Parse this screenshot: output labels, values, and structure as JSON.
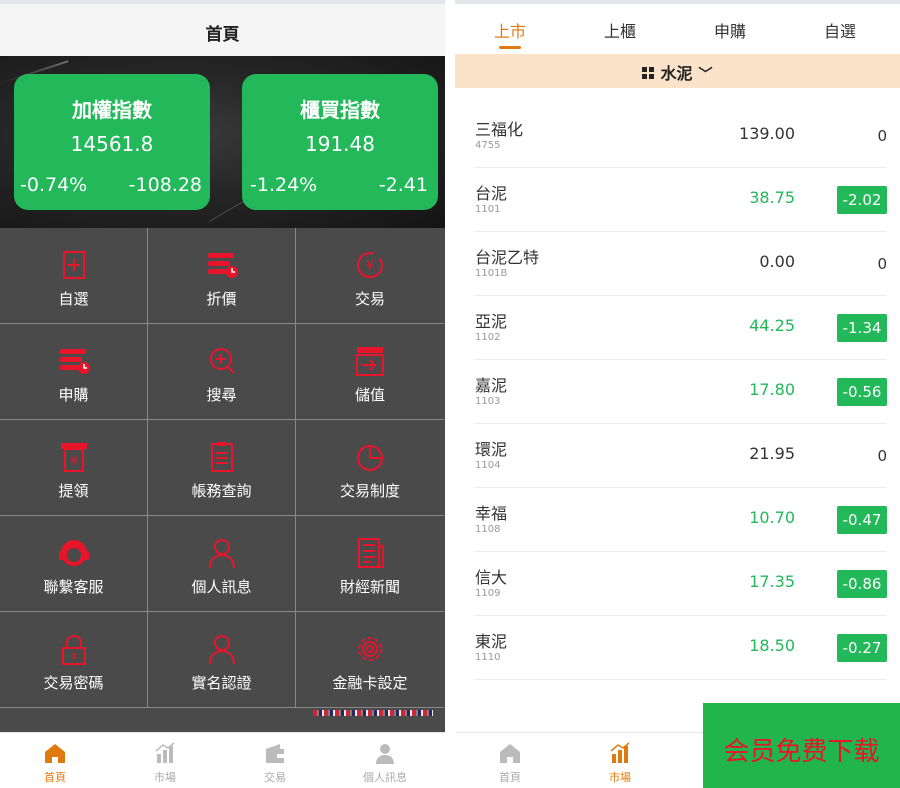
{
  "left": {
    "header_title": "首頁",
    "indices": [
      {
        "name": "加權指數",
        "value": "14561.8",
        "pct": "-0.74%",
        "change": "-108.28"
      },
      {
        "name": "櫃買指數",
        "value": "191.48",
        "pct": "-1.24%",
        "change": "-2.41"
      }
    ],
    "menu": [
      {
        "label": "自選",
        "icon": "add-favorite-icon"
      },
      {
        "label": "折價",
        "icon": "discount-stack-icon"
      },
      {
        "label": "交易",
        "icon": "yuan-coin-icon"
      },
      {
        "label": "申購",
        "icon": "subscribe-stack-icon"
      },
      {
        "label": "搜尋",
        "icon": "search-icon"
      },
      {
        "label": "儲值",
        "icon": "deposit-icon"
      },
      {
        "label": "提領",
        "icon": "withdraw-icon"
      },
      {
        "label": "帳務查詢",
        "icon": "ledger-icon"
      },
      {
        "label": "交易制度",
        "icon": "pie-chart-icon"
      },
      {
        "label": "聯繫客服",
        "icon": "customer-service-icon"
      },
      {
        "label": "個人訊息",
        "icon": "user-icon"
      },
      {
        "label": "財經新聞",
        "icon": "news-icon"
      },
      {
        "label": "交易密碼",
        "icon": "lock-icon"
      },
      {
        "label": "實名認證",
        "icon": "user-verify-icon"
      },
      {
        "label": "金融卡設定",
        "icon": "gear-icon"
      }
    ],
    "tabbar": [
      {
        "label": "首頁",
        "icon": "home-icon",
        "active": true
      },
      {
        "label": "市場",
        "icon": "market-chart-icon",
        "active": false
      },
      {
        "label": "交易",
        "icon": "wallet-icon",
        "active": false
      },
      {
        "label": "個人訊息",
        "icon": "profile-icon",
        "active": false
      }
    ]
  },
  "right": {
    "tabs": [
      {
        "label": "上市",
        "active": true
      },
      {
        "label": "上櫃",
        "active": false
      },
      {
        "label": "申購",
        "active": false
      },
      {
        "label": "自選",
        "active": false
      }
    ],
    "category": "水泥",
    "stocks": [
      {
        "name": "三福化",
        "code": "4755",
        "price": "139.00",
        "change": "0",
        "down": false
      },
      {
        "name": "台泥",
        "code": "1101",
        "price": "38.75",
        "change": "-2.02",
        "down": true
      },
      {
        "name": "台泥乙特",
        "code": "1101B",
        "price": "0.00",
        "change": "0",
        "down": false
      },
      {
        "name": "亞泥",
        "code": "1102",
        "price": "44.25",
        "change": "-1.34",
        "down": true
      },
      {
        "name": "嘉泥",
        "code": "1103",
        "price": "17.80",
        "change": "-0.56",
        "down": true
      },
      {
        "name": "環泥",
        "code": "1104",
        "price": "21.95",
        "change": "0",
        "down": false
      },
      {
        "name": "幸福",
        "code": "1108",
        "price": "10.70",
        "change": "-0.47",
        "down": true
      },
      {
        "name": "信大",
        "code": "1109",
        "price": "17.35",
        "change": "-0.86",
        "down": true
      },
      {
        "name": "東泥",
        "code": "1110",
        "price": "18.50",
        "change": "-0.27",
        "down": true
      }
    ],
    "tabbar": [
      {
        "label": "首頁",
        "icon": "home-icon",
        "active": false
      },
      {
        "label": "市場",
        "icon": "market-chart-icon",
        "active": true
      }
    ],
    "promo_text": "会员免费下载"
  },
  "colors": {
    "accent": "#e07a10",
    "down_green": "#23b85a",
    "icon_red": "#e8142a",
    "grid_bg": "#4a4a4a",
    "category_bg": "#fbe3c9"
  }
}
